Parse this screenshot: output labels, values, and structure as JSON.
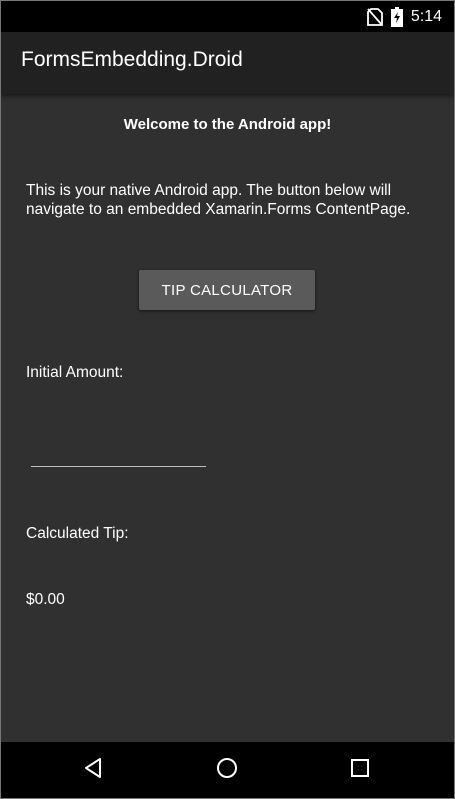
{
  "status_bar": {
    "time": "5:14",
    "icons": [
      "no-sim-icon",
      "battery-charging-icon"
    ]
  },
  "app_bar": {
    "title": "FormsEmbedding.Droid"
  },
  "main": {
    "welcome": "Welcome to the Android app!",
    "description": "This is your native Android app. The button below will navigate to an embedded Xamarin.Forms ContentPage.",
    "tip_button_label": "TIP CALCULATOR",
    "initial_amount_label": "Initial Amount:",
    "initial_amount_value": "",
    "calculated_tip_label": "Calculated Tip:",
    "calculated_tip_value": "$0.00"
  },
  "nav_bar": {
    "icons": [
      "back-icon",
      "home-icon",
      "recents-icon"
    ]
  },
  "colors": {
    "background": "#303030",
    "app_bar": "#212121",
    "button": "#5a5a5a",
    "text": "#ffffff"
  }
}
